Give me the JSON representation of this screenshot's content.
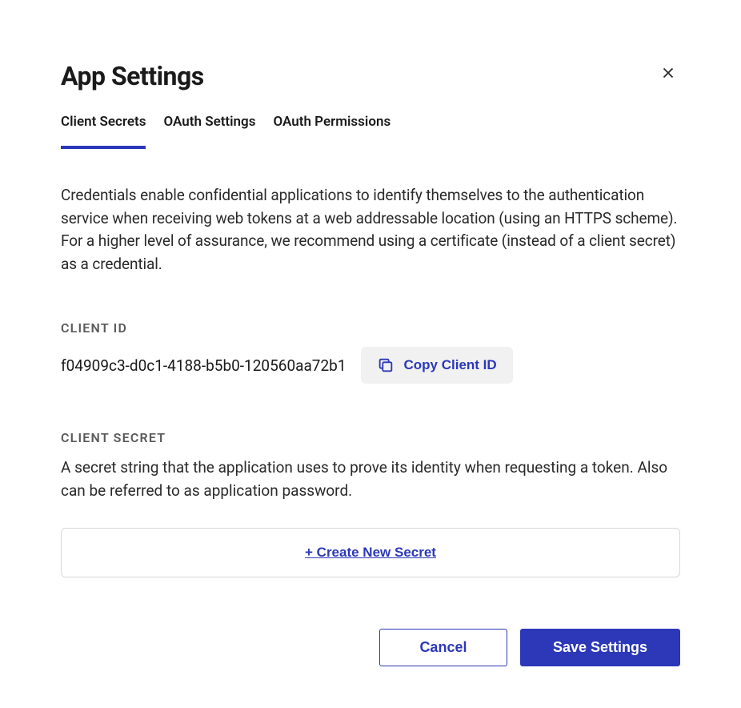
{
  "header": {
    "title": "App Settings"
  },
  "tabs": {
    "client_secrets": "Client Secrets",
    "oauth_settings": "OAuth Settings",
    "oauth_permissions": "OAuth Permissions"
  },
  "description": "Credentials enable confidential applications to identify themselves to the authentication service when receiving web tokens at a web addressable location (using an HTTPS scheme). For a higher level of assurance, we recommend using a certificate (instead of a client secret) as a credential.",
  "client_id": {
    "label": "CLIENT ID",
    "value": "f04909c3-d0c1-4188-b5b0-120560aa72b1",
    "copy_label": "Copy Client ID"
  },
  "client_secret": {
    "label": "CLIENT SECRET",
    "description": "A secret string that the application uses to prove its identity when requesting a token. Also can be referred to as application password.",
    "create_label": "+ Create New Secret"
  },
  "footer": {
    "cancel": "Cancel",
    "save": "Save Settings"
  }
}
